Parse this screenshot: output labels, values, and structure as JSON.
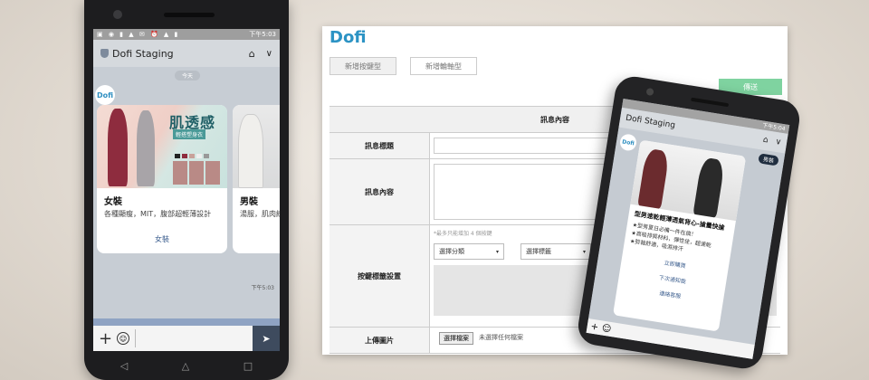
{
  "phone1": {
    "status_time": "下午5:03",
    "chat_title": "Dofi Staging",
    "date_label": "今天",
    "avatar_logo": "Dofi",
    "cards": [
      {
        "promo_title": "肌透感",
        "promo_sub": "輕搭塑身衣",
        "title": "女裝",
        "desc": "各種顯瘦，MIT，腹部超輕薄設計",
        "action": "女裝"
      },
      {
        "title": "男裝",
        "desc": "湯服，肌肉線"
      }
    ],
    "message_time": "下午5:03",
    "nav": [
      "◁",
      "△",
      "□"
    ]
  },
  "admin": {
    "logo": "Dofi",
    "tabs": [
      "新增按鍵型",
      "新增輪軸型"
    ],
    "send_button": "傳送",
    "table_header": "訊息內容",
    "rows": {
      "subject_label": "訊息標題",
      "content_label": "訊息內容",
      "buttons_label": "按鍵標籤設置",
      "upload_label": "上傳圖片"
    },
    "buttons_hint": "*最多只能增加 4 個按鍵",
    "select_category": "選擇分類",
    "select_label": "選擇標籤",
    "file_button": "選擇檔案",
    "file_status": "未選擇任何檔案"
  },
  "phone2": {
    "status_time": "下午5:04",
    "chat_title": "Dofi Staging",
    "avatar_logo": "Dofi",
    "bubble": "男裝",
    "card_title": "型男速乾輕薄透氣背心-搶量快搶",
    "bullets": [
      "★型男夏日必備一件在搞！",
      "★高吸排質材料，彈性佳，超速乾",
      "★剪裁舒適，吸濕排汗"
    ],
    "actions": [
      "立即購買",
      "下次通知我",
      "連絡客服"
    ]
  },
  "colors": {
    "brand": "#2c93c4",
    "send": "#7fd3a0",
    "chat_bg": "#c7cdd4"
  }
}
